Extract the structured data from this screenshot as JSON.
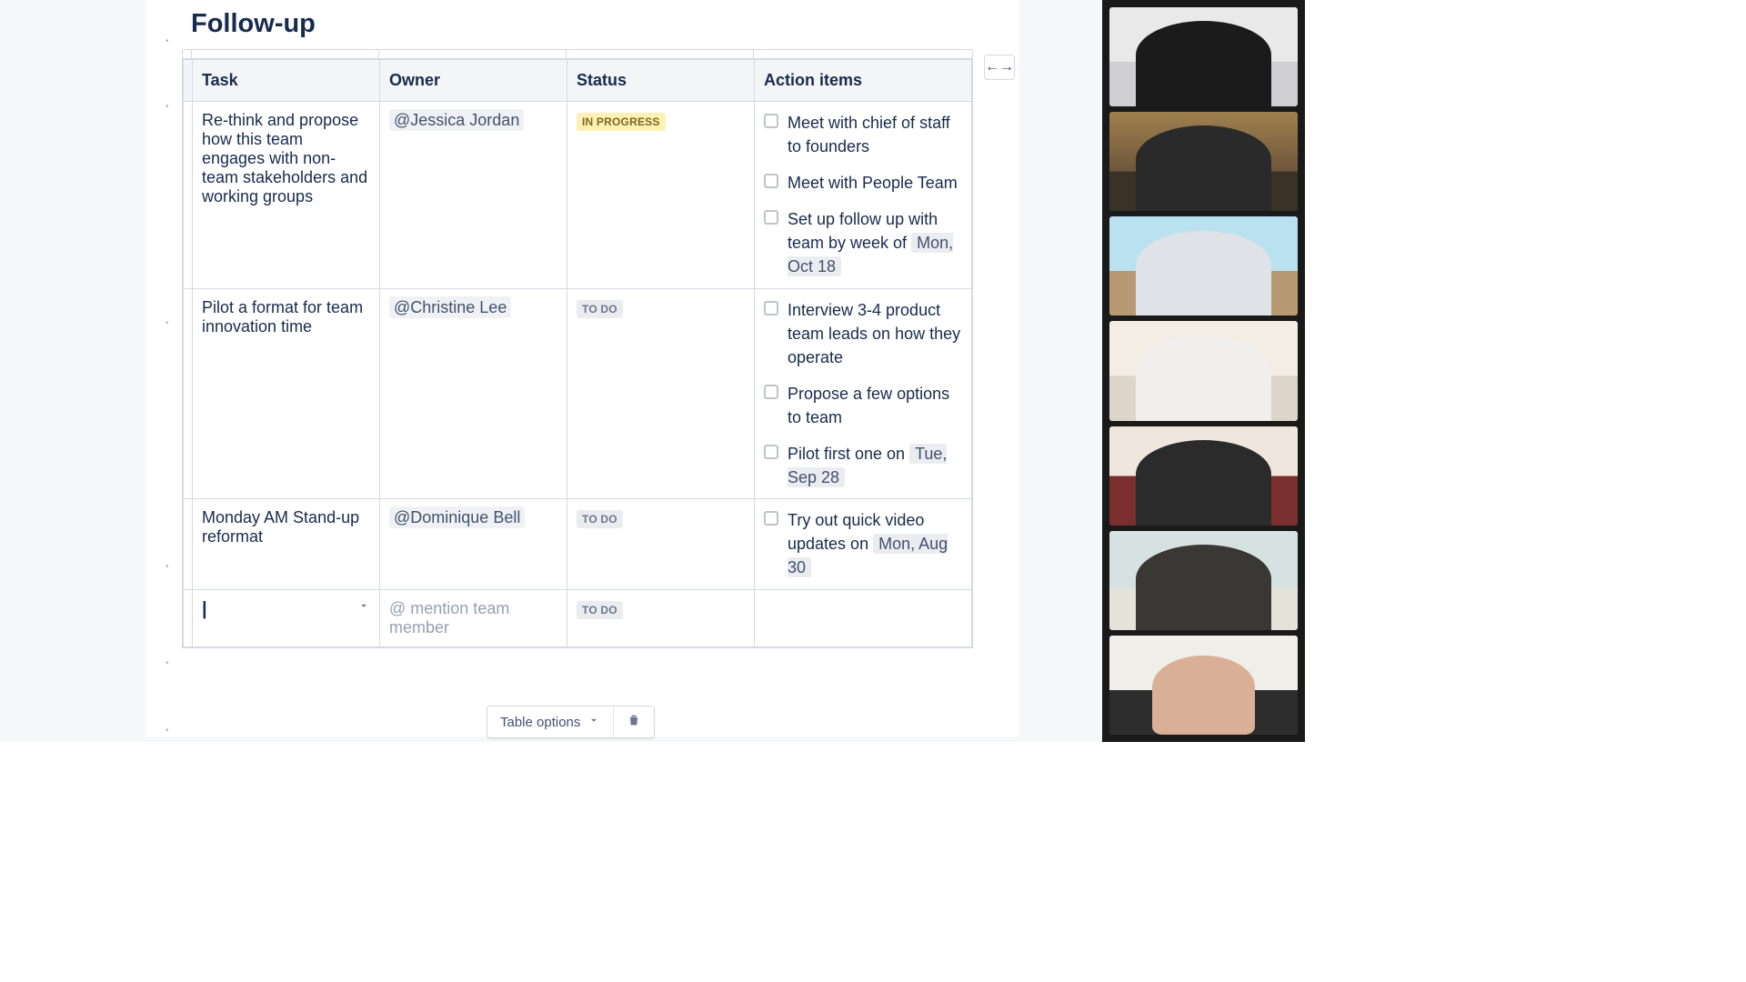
{
  "heading": "Follow-up",
  "columns": {
    "task": "Task",
    "owner": "Owner",
    "status": "Status",
    "action": "Action items"
  },
  "status_labels": {
    "in_progress": "IN PROGRESS",
    "to_do": "TO DO"
  },
  "rows": [
    {
      "task": "Re-think and propose how this team engages with non-team stakeholders and working groups",
      "owner": "@Jessica Jordan",
      "status": "in_progress",
      "actions": [
        {
          "text": "Meet with chief of staff to founders"
        },
        {
          "text": "Meet with People Team"
        },
        {
          "text_pre": "Set up follow up with team by week of ",
          "date": "Mon, Oct 18"
        }
      ]
    },
    {
      "task": "Pilot a format for team innovation time",
      "owner": "@Christine Lee",
      "status": "to_do",
      "actions": [
        {
          "text": "Interview 3-4 product team leads on how they operate"
        },
        {
          "text": "Propose a few options to team"
        },
        {
          "text_pre": "Pilot first one on ",
          "date": "Tue, Sep 28"
        }
      ]
    },
    {
      "task": "Monday AM Stand-up reformat",
      "owner": "@Dominique Bell",
      "status": "to_do",
      "actions": [
        {
          "text_pre": "Try out quick video updates on ",
          "date": "Mon, Aug 30"
        }
      ]
    }
  ],
  "new_row": {
    "owner_placeholder": "@ mention team member",
    "status": "to_do"
  },
  "toolbar": {
    "options_label": "Table options"
  },
  "video_tiles": 7
}
